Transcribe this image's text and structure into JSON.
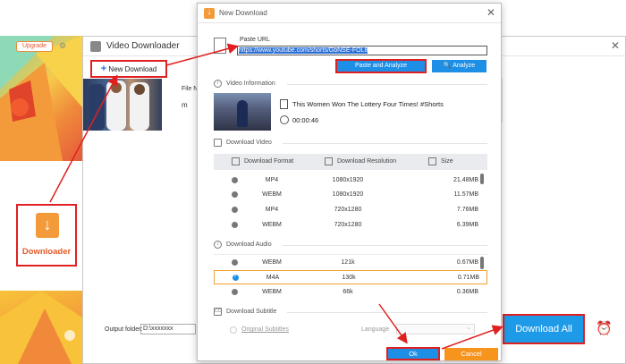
{
  "bg_app": {
    "upgrade_label": "Upgrade",
    "downloader_label": "Downloader",
    "gear_icon": "gear-icon"
  },
  "video_downloader": {
    "title": "Video Downloader",
    "new_download_label": "New Download",
    "file_name_label": "File Na",
    "file_row_text": "m",
    "output_folder_label": "Output folder:",
    "output_folder_value": "D:\\xxxxxxx",
    "download_all_label": "Download All",
    "alarm_icon": "alarm-clock-icon"
  },
  "new_download": {
    "title": "New Download",
    "paste_url_label": "Paste URL",
    "url_value": "https://www.youtube.com/shorts/GbNSE-FOL8",
    "paste_analyze_label": "Paste and Analyze",
    "analyze_label": "Analyze",
    "video_info_label": "Video Information",
    "video_title": "This Women Won The Lottery Four Times! #Shorts",
    "video_duration": "00:00:46",
    "download_video_label": "Download Video",
    "download_audio_label": "Download Audio",
    "download_subtitle_label": "Download Subtitle",
    "columns": {
      "format": "Download Format",
      "resolution": "Download Resolution",
      "size": "Size"
    },
    "video_rows": [
      {
        "format": "MP4",
        "resolution": "1080x1920",
        "size": "21.48MB"
      },
      {
        "format": "WEBM",
        "resolution": "1080x1920",
        "size": "11.57MB"
      },
      {
        "format": "MP4",
        "resolution": "720x1280",
        "size": "7.76MB"
      },
      {
        "format": "WEBM",
        "resolution": "720x1280",
        "size": "6.39MB"
      }
    ],
    "audio_rows": [
      {
        "format": "WEBM",
        "resolution": "121k",
        "size": "0.67MB"
      },
      {
        "format": "M4A",
        "resolution": "130k",
        "size": "0.71MB"
      },
      {
        "format": "WEBM",
        "resolution": "66k",
        "size": "0.36MB"
      }
    ],
    "original_subtitles_label": "Original Subtitles",
    "language_label": "Language",
    "ok_label": "Ok",
    "cancel_label": "Cancel"
  },
  "colors": {
    "accent_blue": "#1e8fe6",
    "highlight_red": "#e02020",
    "cancel_orange": "#f7941d",
    "brand_orange": "#f39a3a"
  }
}
